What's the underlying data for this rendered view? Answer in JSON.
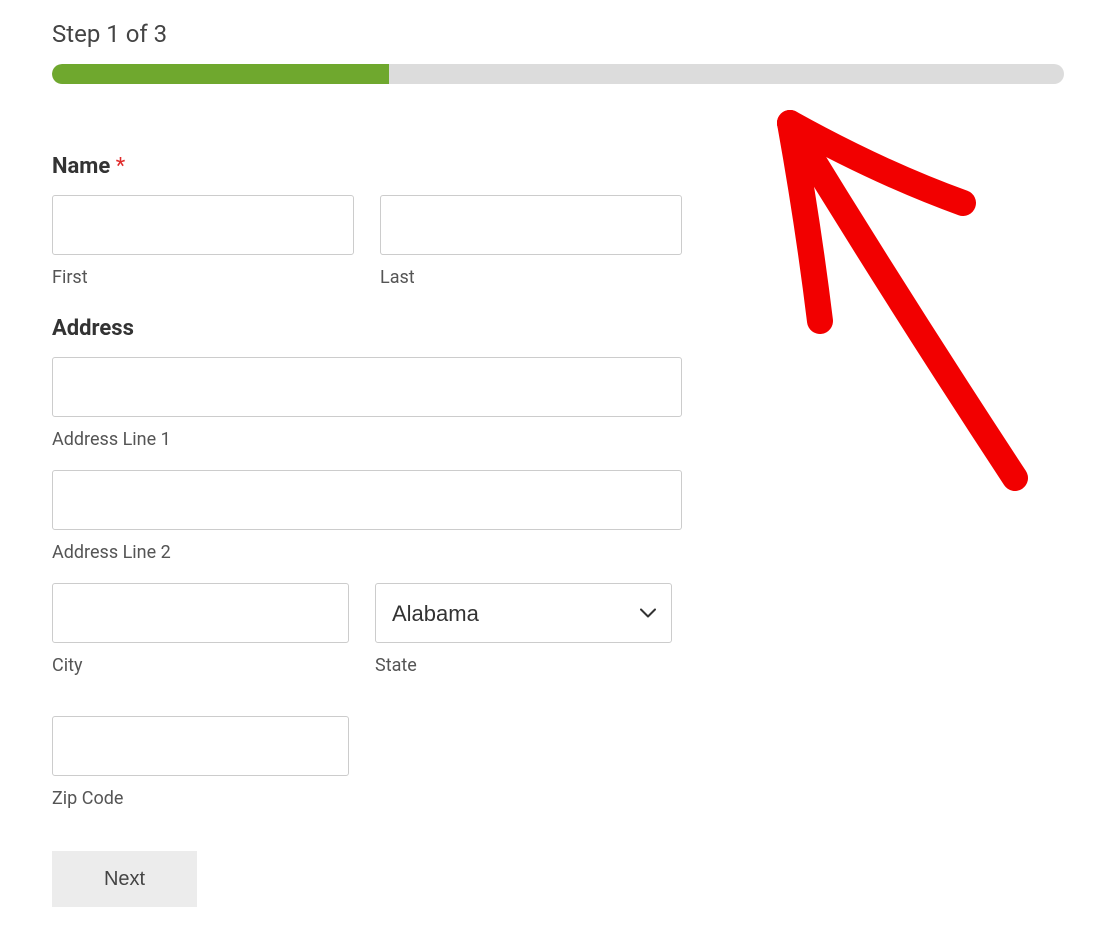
{
  "progress": {
    "step_label": "Step 1 of 3",
    "percent": 33.33,
    "fill_color": "#6fa82e",
    "track_color": "#dcdcdc"
  },
  "form": {
    "name": {
      "label": "Name",
      "required_mark": "*",
      "first": {
        "sublabel": "First",
        "value": ""
      },
      "last": {
        "sublabel": "Last",
        "value": ""
      }
    },
    "address": {
      "label": "Address",
      "line1": {
        "sublabel": "Address Line 1",
        "value": ""
      },
      "line2": {
        "sublabel": "Address Line 2",
        "value": ""
      },
      "city": {
        "sublabel": "City",
        "value": ""
      },
      "state": {
        "sublabel": "State",
        "selected": "Alabama"
      },
      "zip": {
        "sublabel": "Zip Code",
        "value": ""
      }
    }
  },
  "actions": {
    "next_label": "Next"
  },
  "annotation": {
    "arrow_color": "#f20000"
  }
}
